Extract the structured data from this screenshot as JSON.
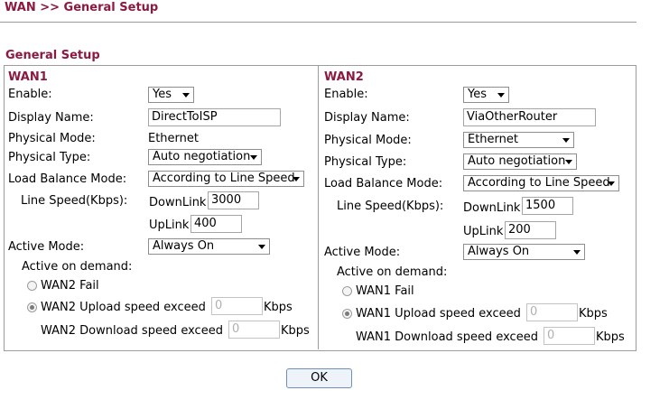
{
  "breadcrumb": "WAN >> General Setup",
  "section_title": "General Setup",
  "wan1": {
    "title": "WAN1",
    "enable_label": "Enable:",
    "enable_value": "Yes",
    "display_name_label": "Display Name:",
    "display_name_value": "DirectToISP",
    "physical_mode_label": "Physical Mode:",
    "physical_mode_value": "Ethernet",
    "physical_type_label": "Physical Type:",
    "physical_type_value": "Auto negotiation",
    "load_balance_label": "Load Balance Mode:",
    "load_balance_value": "According to Line Speed",
    "line_speed_label": "Line Speed(Kbps):",
    "downlink_label": "DownLink",
    "downlink_value": "3000",
    "uplink_label": "UpLink",
    "uplink_value": "400",
    "active_mode_label": "Active Mode:",
    "active_mode_value": "Always On",
    "active_on_demand_label": "Active on demand:",
    "fail_label": "WAN2 Fail",
    "upload_exceed_label": "WAN2 Upload speed exceed",
    "upload_exceed_value": "0",
    "download_exceed_label": "WAN2 Download speed exceed",
    "download_exceed_value": "0",
    "kbps_label": "Kbps"
  },
  "wan2": {
    "title": "WAN2",
    "enable_label": "Enable:",
    "enable_value": "Yes",
    "display_name_label": "Display Name:",
    "display_name_value": "ViaOtherRouter",
    "physical_mode_label": "Physical Mode:",
    "physical_mode_value": "Ethernet",
    "physical_type_label": "Physical Type:",
    "physical_type_value": "Auto negotiation",
    "load_balance_label": "Load Balance Mode:",
    "load_balance_value": "According to Line Speed",
    "line_speed_label": "Line Speed(Kbps):",
    "downlink_label": "DownLink",
    "downlink_value": "1500",
    "uplink_label": "UpLink",
    "uplink_value": "200",
    "active_mode_label": "Active Mode:",
    "active_mode_value": "Always On",
    "active_on_demand_label": "Active on demand:",
    "fail_label": "WAN1 Fail",
    "upload_exceed_label": "WAN1 Upload speed exceed",
    "upload_exceed_value": "0",
    "download_exceed_label": "WAN1 Download speed exceed",
    "download_exceed_value": "0",
    "kbps_label": "Kbps"
  },
  "ok_label": "OK",
  "colors": {
    "accent": "#8b1a3e",
    "border": "#9c9c9c"
  }
}
